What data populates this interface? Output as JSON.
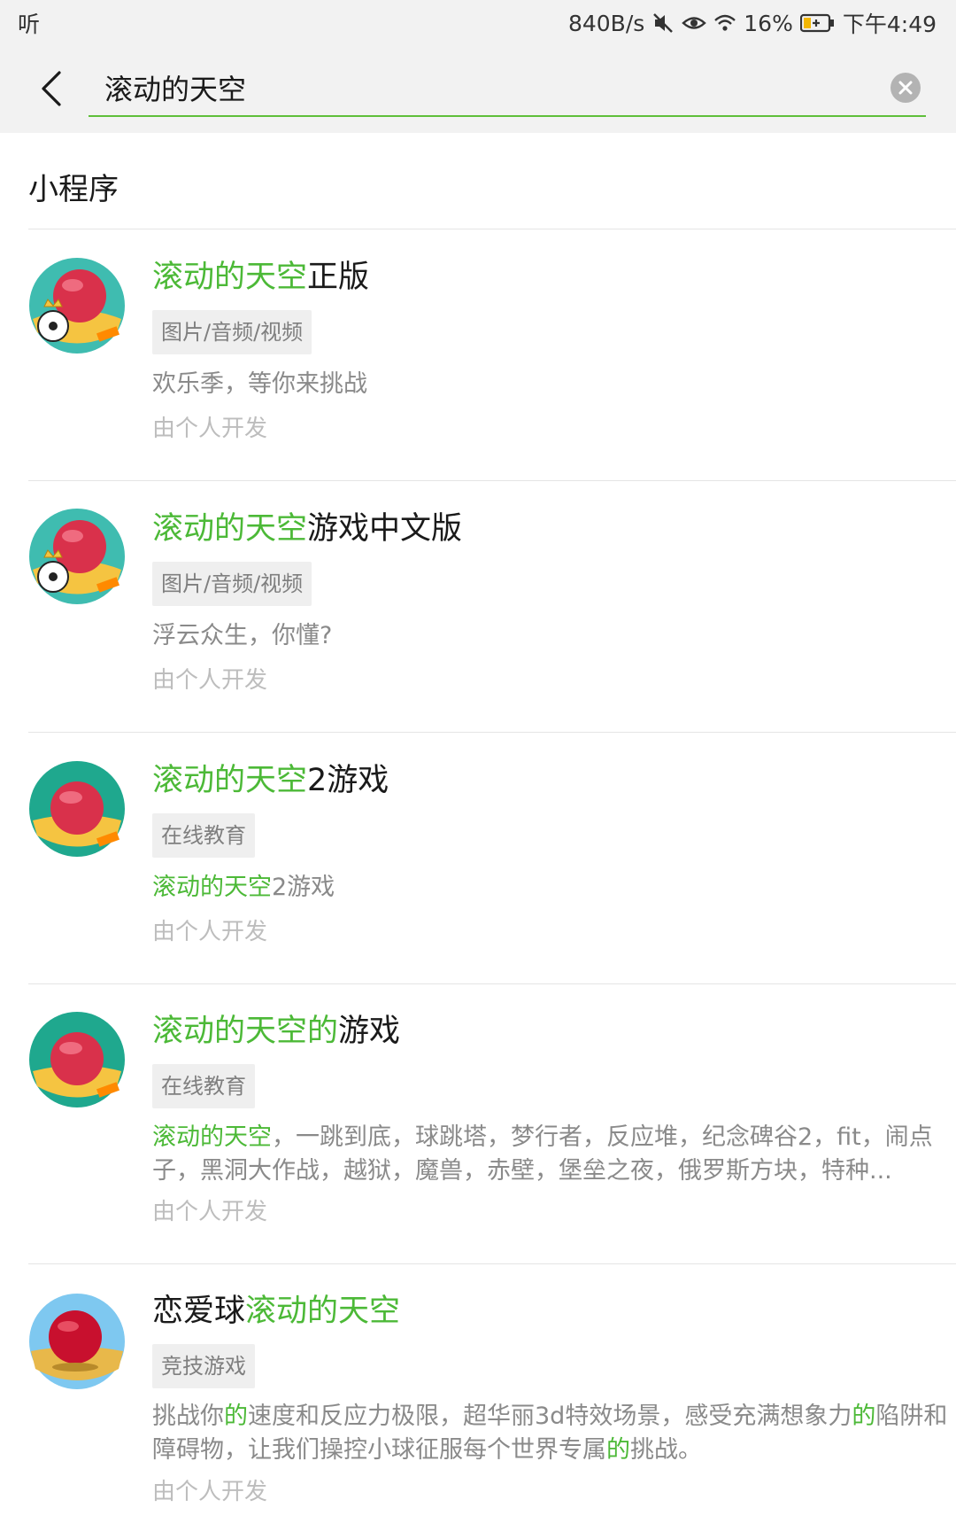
{
  "status_bar": {
    "left_icon": "hearing-aid-icon",
    "left_text": "听",
    "net_speed": "840B/s",
    "battery_percent": "16%",
    "time": "下午4:49"
  },
  "search": {
    "query": "滚动的天空",
    "accent_color": "#5fbf3a"
  },
  "section": {
    "title": "小程序"
  },
  "results": [
    {
      "title_highlight": "滚动的天空",
      "title_rest": "正版",
      "tag": "图片/音频/视频",
      "desc": "欢乐季，等你来挑战",
      "developer": "由个人开发"
    },
    {
      "title_highlight": "滚动的天空",
      "title_rest": "游戏中文版",
      "tag": "图片/音频/视频",
      "desc": "浮云众生，你懂?",
      "developer": "由个人开发"
    },
    {
      "title_highlight": "滚动的天空",
      "title_rest": "2游戏",
      "tag": "在线教育",
      "desc_highlight": "滚动的天空",
      "desc_rest": "2游戏",
      "developer": "由个人开发"
    },
    {
      "title_highlight": "滚动的天空的",
      "title_rest": "游戏",
      "tag": "在线教育",
      "desc_highlight": "滚动的天空",
      "desc_rest": "，一跳到底，球跳塔，梦行者，反应堆，纪念碑谷2，fit，闹点子，黑洞大作战，越狱，魔兽，赤壁，堡垒之夜，俄罗斯方块，特种...",
      "developer": "由个人开发"
    },
    {
      "title_pre": "恋爱球",
      "title_highlight": "滚动的天空",
      "tag": "竞技游戏",
      "desc_parts": [
        "挑战你",
        "的",
        "速度和反应力极限，超华丽3d特效场景，感受充满想象力",
        "的",
        "陷阱和障碍物，让我们操控小球征服每个世界专属",
        "的",
        "挑战。"
      ],
      "developer": "由个人开发"
    }
  ],
  "colors": {
    "highlight": "#4cb937",
    "tag_bg": "#efefef",
    "dev_text": "#bdbdbd"
  }
}
